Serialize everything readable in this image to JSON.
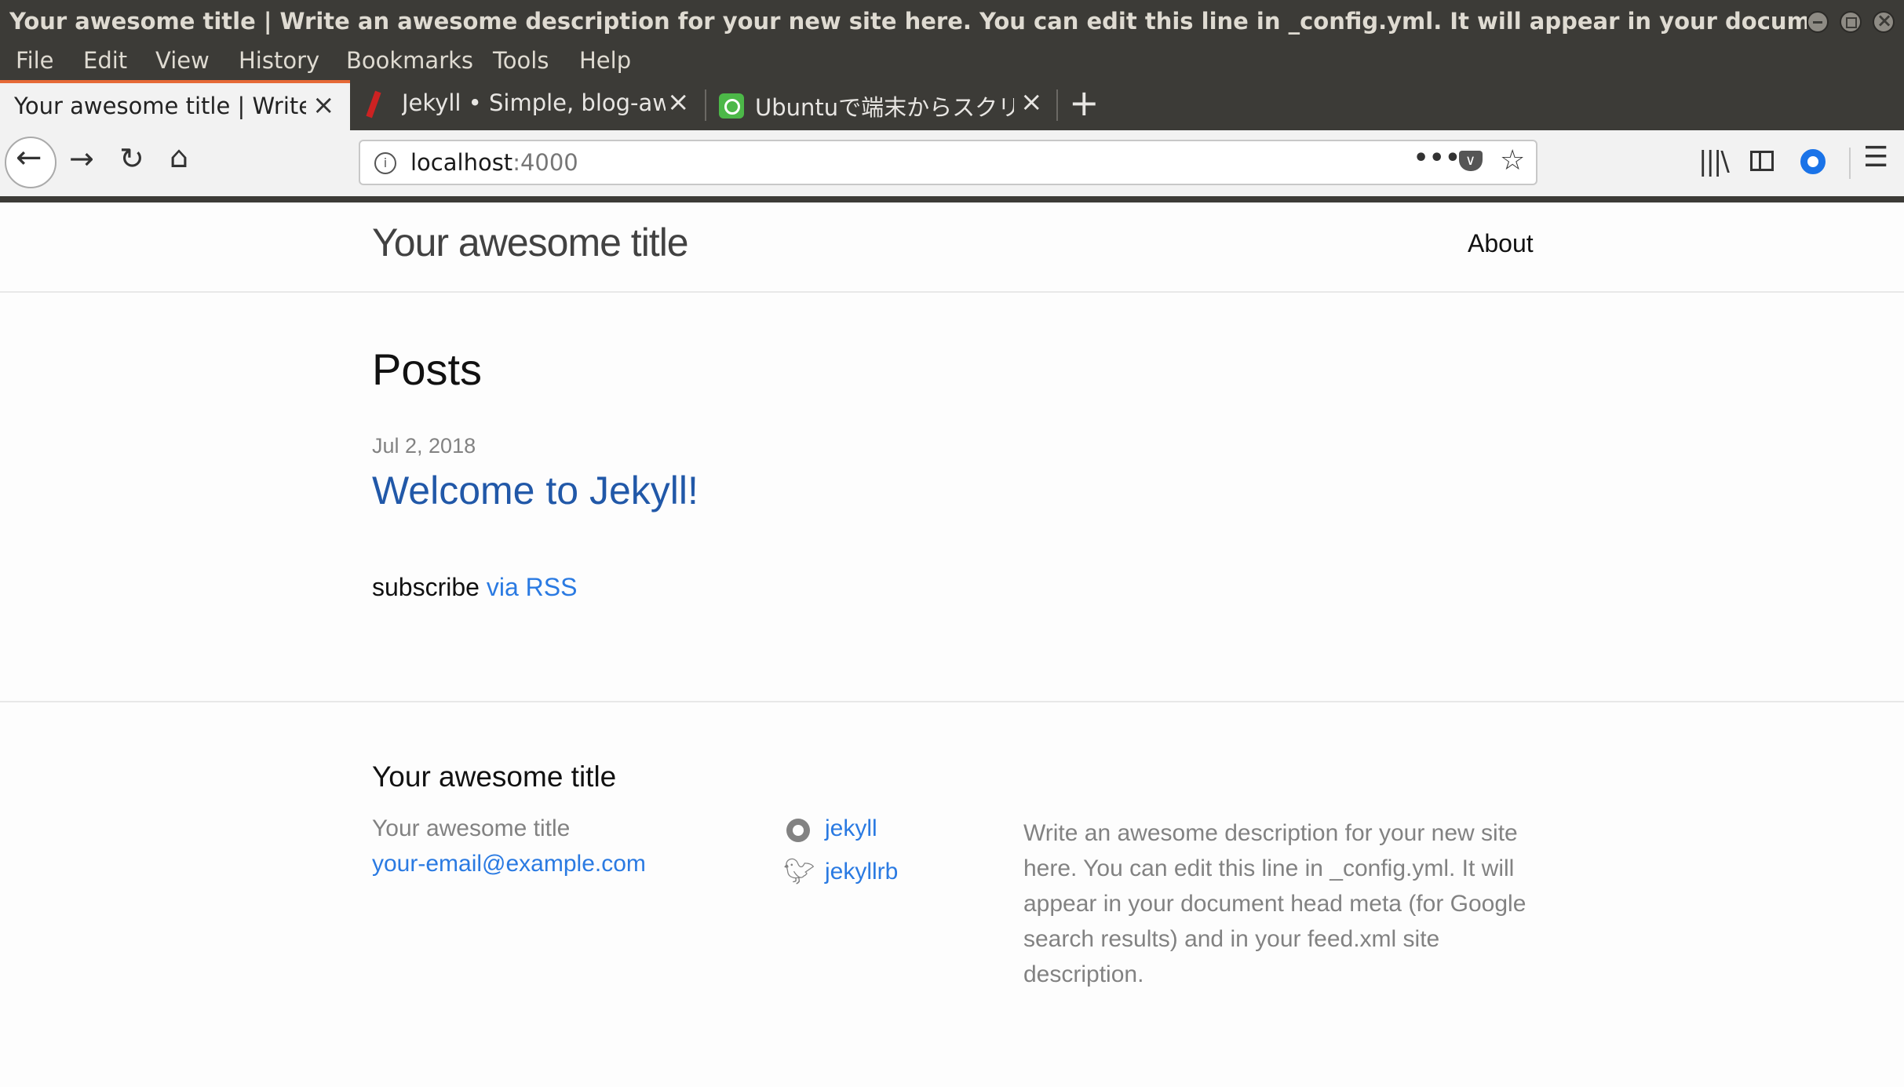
{
  "window": {
    "title": "Your awesome title | Write an awesome description for your new site here. You can edit this line in _config.yml. It will appear in your document head meta (fo..."
  },
  "menu": [
    "File",
    "Edit",
    "View",
    "History",
    "Bookmarks",
    "Tools",
    "Help"
  ],
  "tabs": [
    {
      "label": "Your awesome title | Write a",
      "active": true
    },
    {
      "label": "Jekyll • Simple, blog-awa",
      "active": false
    },
    {
      "label": "Ubuntuで端末からスクリ",
      "active": false
    }
  ],
  "toolbar": {
    "url_host": "localhost",
    "url_port": ":4000"
  },
  "site": {
    "title": "Your awesome title",
    "nav_about": "About",
    "posts_heading": "Posts",
    "post_date": "Jul 2, 2018",
    "post_title": "Welcome to Jekyll!",
    "subscribe_text": "subscribe",
    "subscribe_link": "via RSS"
  },
  "footer": {
    "heading": "Your awesome title",
    "name": "Your awesome title",
    "email": "your-email@example.com",
    "github": "jekyll",
    "twitter": "jekyllrb",
    "description": "Write an awesome description for your new site here. You can edit this line in _config.yml. It will appear in your document head meta (for Google search results) and in your feed.xml site description."
  },
  "colors": {
    "chrome_dark": "#3c3b37",
    "tab_accent": "#e66a37",
    "link": "#2a7ae2",
    "muted": "#828282"
  }
}
